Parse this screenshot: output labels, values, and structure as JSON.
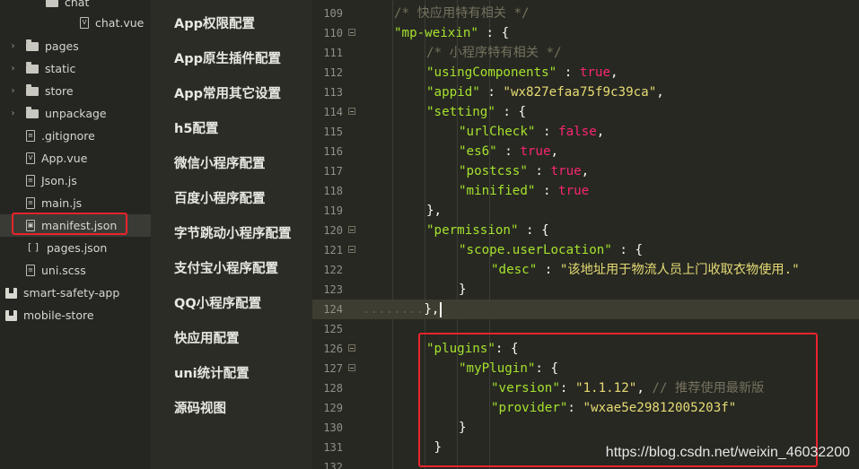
{
  "file_tree": {
    "items": [
      {
        "label": "chat",
        "type": "folder",
        "expanded": true,
        "depth": 2
      },
      {
        "label": "chat.vue",
        "type": "file",
        "icon": "vue-file-icon",
        "depth": 3
      },
      {
        "label": "pages",
        "type": "folder",
        "depth": 1
      },
      {
        "label": "static",
        "type": "folder",
        "depth": 1
      },
      {
        "label": "store",
        "type": "folder",
        "depth": 1
      },
      {
        "label": "unpackage",
        "type": "folder",
        "depth": 1
      },
      {
        "label": ".gitignore",
        "type": "file",
        "icon": "file-icon",
        "depth": 1
      },
      {
        "label": "App.vue",
        "type": "file",
        "icon": "vue-file-icon",
        "depth": 1
      },
      {
        "label": "Json.js",
        "type": "file",
        "icon": "js-file-icon",
        "depth": 1
      },
      {
        "label": "main.js",
        "type": "file",
        "icon": "js-file-icon",
        "depth": 1
      },
      {
        "label": "manifest.json",
        "type": "file",
        "icon": "manifest-file-icon",
        "depth": 1,
        "selected": true
      },
      {
        "label": "pages.json",
        "type": "file",
        "icon": "json-file-icon",
        "depth": 1
      },
      {
        "label": "uni.scss",
        "type": "file",
        "icon": "scss-file-icon",
        "depth": 1
      },
      {
        "label": "smart-safety-app",
        "type": "project",
        "icon": "project-icon",
        "depth": 0
      },
      {
        "label": "mobile-store",
        "type": "project",
        "icon": "project-icon",
        "depth": 0
      }
    ]
  },
  "settings_nav": {
    "items": [
      "App权限配置",
      "App原生插件配置",
      "App常用其它设置",
      "h5配置",
      "微信小程序配置",
      "百度小程序配置",
      "字节跳动小程序配置",
      "支付宝小程序配置",
      "QQ小程序配置",
      "快应用配置",
      "uni统计配置",
      "源码视图"
    ]
  },
  "editor": {
    "lines": [
      {
        "n": "109",
        "fold": false,
        "indent": 1,
        "tokens": [
          [
            "cmt",
            "/* 快应用特有相关 */"
          ]
        ]
      },
      {
        "n": "110",
        "fold": true,
        "indent": 1,
        "tokens": [
          [
            "keyq",
            "\"mp-weixin\""
          ],
          [
            "pun",
            " : {"
          ]
        ]
      },
      {
        "n": "111",
        "fold": false,
        "indent": 2,
        "tokens": [
          [
            "cmt",
            "/* 小程序特有相关 */"
          ]
        ]
      },
      {
        "n": "112",
        "fold": false,
        "indent": 2,
        "tokens": [
          [
            "keyq",
            "\"usingComponents\""
          ],
          [
            "pun",
            " : "
          ],
          [
            "bool",
            "true"
          ],
          [
            "pun",
            ","
          ]
        ]
      },
      {
        "n": "113",
        "fold": false,
        "indent": 2,
        "tokens": [
          [
            "keyq",
            "\"appid\""
          ],
          [
            "pun",
            " : "
          ],
          [
            "str",
            "\"wx827efaa75f9c39ca\""
          ],
          [
            "pun",
            ","
          ]
        ]
      },
      {
        "n": "114",
        "fold": true,
        "indent": 2,
        "tokens": [
          [
            "keyq",
            "\"setting\""
          ],
          [
            "pun",
            " : {"
          ]
        ]
      },
      {
        "n": "115",
        "fold": false,
        "indent": 3,
        "tokens": [
          [
            "keyq",
            "\"urlCheck\""
          ],
          [
            "pun",
            " : "
          ],
          [
            "bool",
            "false"
          ],
          [
            "pun",
            ","
          ]
        ]
      },
      {
        "n": "116",
        "fold": false,
        "indent": 3,
        "tokens": [
          [
            "keyq",
            "\"es6\""
          ],
          [
            "pun",
            " : "
          ],
          [
            "bool",
            "true"
          ],
          [
            "pun",
            ","
          ]
        ]
      },
      {
        "n": "117",
        "fold": false,
        "indent": 3,
        "tokens": [
          [
            "keyq",
            "\"postcss\""
          ],
          [
            "pun",
            " : "
          ],
          [
            "bool",
            "true"
          ],
          [
            "pun",
            ","
          ]
        ]
      },
      {
        "n": "118",
        "fold": false,
        "indent": 3,
        "tokens": [
          [
            "keyq",
            "\"minified\""
          ],
          [
            "pun",
            " : "
          ],
          [
            "bool",
            "true"
          ]
        ]
      },
      {
        "n": "119",
        "fold": false,
        "indent": 2,
        "tokens": [
          [
            "pun",
            "},"
          ]
        ]
      },
      {
        "n": "120",
        "fold": true,
        "indent": 2,
        "tokens": [
          [
            "keyq",
            "\"permission\""
          ],
          [
            "pun",
            " : {"
          ]
        ]
      },
      {
        "n": "121",
        "fold": true,
        "indent": 3,
        "tokens": [
          [
            "keyq",
            "\"scope.userLocation\""
          ],
          [
            "pun",
            " : {"
          ]
        ]
      },
      {
        "n": "122",
        "fold": false,
        "indent": 4,
        "tokens": [
          [
            "keyq",
            "\"desc\""
          ],
          [
            "pun",
            " : "
          ],
          [
            "str",
            "\"该地址用于物流人员上门收取衣物使用.\""
          ]
        ]
      },
      {
        "n": "123",
        "fold": false,
        "indent": 3,
        "tokens": [
          [
            "pun",
            "}"
          ]
        ]
      },
      {
        "n": "124",
        "fold": false,
        "indent": 0,
        "current": true,
        "tokens": [
          [
            "dots",
            "........"
          ],
          [
            "pun",
            "},"
          ]
        ]
      },
      {
        "n": "125",
        "fold": false,
        "indent": 0,
        "tokens": []
      },
      {
        "n": "126",
        "fold": true,
        "indent": 2,
        "tokens": [
          [
            "keyq",
            "\"plugins\""
          ],
          [
            "pun",
            ": {"
          ]
        ]
      },
      {
        "n": "127",
        "fold": true,
        "indent": 3,
        "tokens": [
          [
            "keyq",
            "\"myPlugin\""
          ],
          [
            "pun",
            ": {"
          ]
        ]
      },
      {
        "n": "128",
        "fold": false,
        "indent": 4,
        "tokens": [
          [
            "keyq",
            "\"version\""
          ],
          [
            "pun",
            ": "
          ],
          [
            "str",
            "\"1.1.12\""
          ],
          [
            "pun",
            ", "
          ],
          [
            "cmt",
            "// 推荐使用最新版"
          ]
        ]
      },
      {
        "n": "129",
        "fold": false,
        "indent": 4,
        "tokens": [
          [
            "keyq",
            "\"provider\""
          ],
          [
            "pun",
            ": "
          ],
          [
            "str",
            "\"wxae5e29812005203f\""
          ]
        ]
      },
      {
        "n": "130",
        "fold": false,
        "indent": 3,
        "tokens": [
          [
            "pun",
            "}"
          ]
        ]
      },
      {
        "n": "131",
        "fold": false,
        "indent": 2,
        "tokens": [
          [
            "pun",
            " }"
          ]
        ]
      },
      {
        "n": "132",
        "fold": false,
        "indent": 0,
        "tokens": []
      }
    ]
  },
  "watermark": "https://blog.csdn.net/weixin_46032200",
  "colors": {
    "highlight_border": "#e8242c",
    "editor_bg": "#272822",
    "string": "#e6db74",
    "key": "#a6e22e",
    "bool": "#f92672",
    "comment": "#75715e"
  }
}
